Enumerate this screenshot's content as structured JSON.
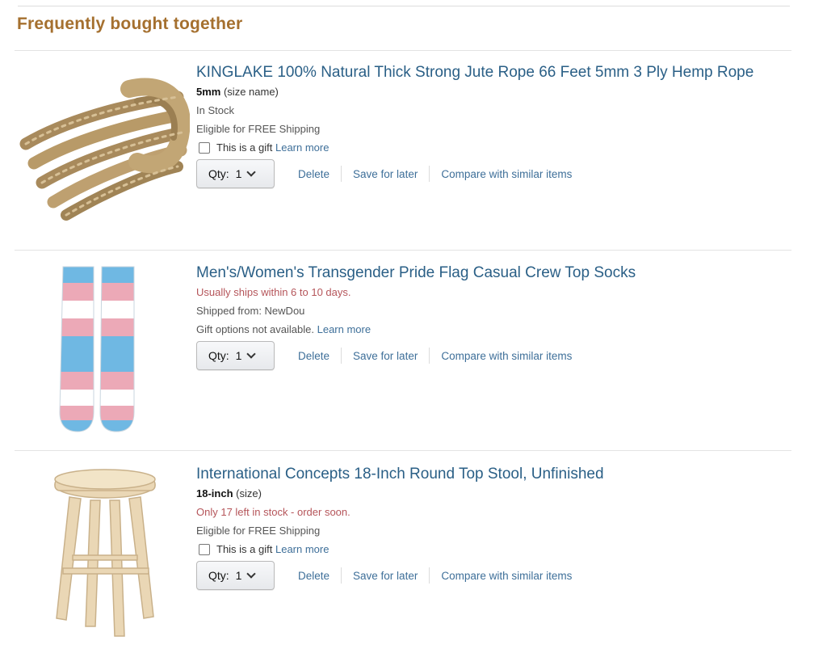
{
  "section": {
    "title": "Frequently bought together"
  },
  "items": [
    {
      "title": "KINGLAKE 100% Natural Thick Strong Jute Rope 66 Feet 5mm 3 Ply Hemp Rope",
      "variant_value": "5mm",
      "variant_label": " (size name)",
      "stock": "In Stock",
      "shipping": "Eligible for FREE Shipping",
      "gift_label": "This is a gift",
      "gift_link": "Learn more",
      "qty_label": "Qty:",
      "qty_value": "1",
      "delete": "Delete",
      "save_for_later": "Save for later",
      "compare": "Compare with similar items",
      "image_icon": "rope-icon"
    },
    {
      "title": "Men's/Women's Transgender Pride Flag Casual Crew Top Socks",
      "ships": "Usually ships within 6 to 10 days.",
      "shipped_from": "Shipped from: NewDou",
      "gift_options": "Gift options not available.",
      "gift_link": "Learn more",
      "qty_label": "Qty:",
      "qty_value": "1",
      "delete": "Delete",
      "save_for_later": "Save for later",
      "compare": "Compare with similar items",
      "image_icon": "socks-icon",
      "sock_colors": {
        "blue": "#6fb8e3",
        "pink": "#eca9b7",
        "white": "#ffffff"
      }
    },
    {
      "title": "International Concepts 18-Inch Round Top Stool, Unfinished",
      "variant_value": "18-inch",
      "variant_label": " (size)",
      "stock": "Only 17 left in stock - order soon.",
      "shipping": "Eligible for FREE Shipping",
      "gift_label": "This is a gift",
      "gift_link": "Learn more",
      "qty_label": "Qty:",
      "qty_value": "1",
      "delete": "Delete",
      "save_for_later": "Save for later",
      "compare": "Compare with similar items",
      "image_icon": "stool-icon"
    }
  ],
  "colors": {
    "section_title": "#a5702f",
    "title_link": "#2a5f86",
    "action_link": "#3e6f99",
    "stock_warning": "#b5555a"
  }
}
